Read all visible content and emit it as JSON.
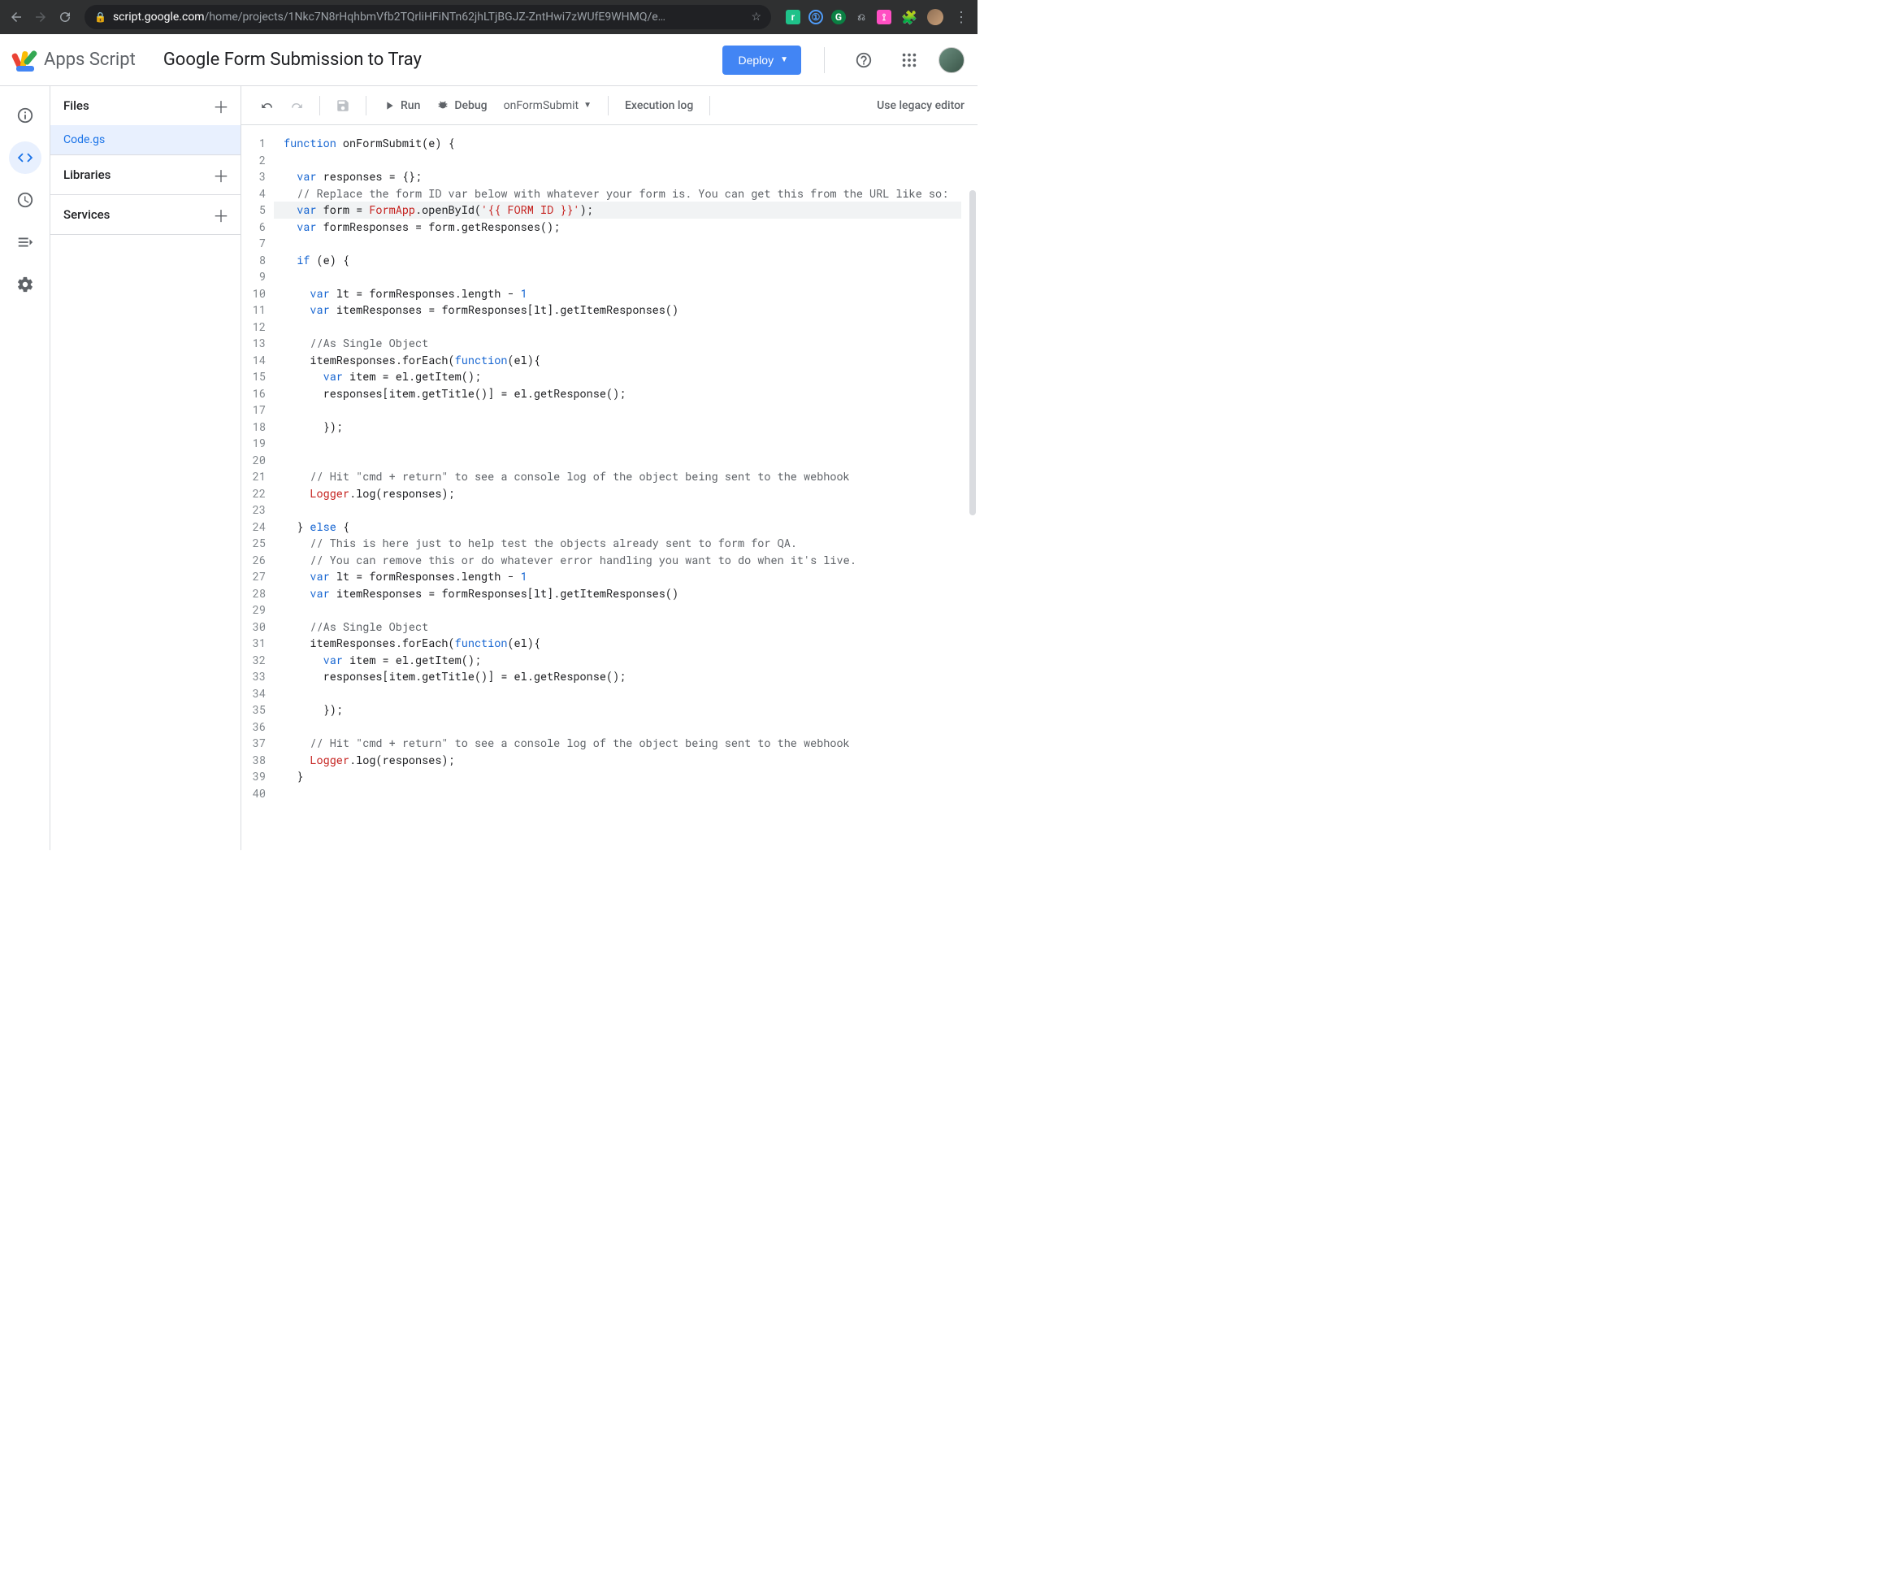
{
  "browser": {
    "url_host": "script.google.com",
    "url_path": "/home/projects/1Nkc7N8rHqhbmVfb2TQrliHFiNTn62jhLTjBGJZ-ZntHwi7zWUfE9WHMQ/e…"
  },
  "header": {
    "product_name": "Apps Script",
    "project_title": "Google Form Submission to Tray",
    "deploy_label": "Deploy"
  },
  "sidebar": {
    "files_label": "Files",
    "file_name": "Code.gs",
    "libraries_label": "Libraries",
    "services_label": "Services"
  },
  "toolbar": {
    "run_label": "Run",
    "debug_label": "Debug",
    "function_selected": "onFormSubmit",
    "execution_log": "Execution log",
    "legacy_link": "Use legacy editor"
  },
  "code": {
    "lines": [
      {
        "n": 1,
        "t": "plain",
        "tokens": [
          [
            "kw",
            "function"
          ],
          [
            "",
            " onFormSubmit(e) {"
          ]
        ]
      },
      {
        "n": 2,
        "t": "plain",
        "tokens": [
          [
            "",
            ""
          ]
        ]
      },
      {
        "n": 3,
        "t": "plain",
        "tokens": [
          [
            "",
            "  "
          ],
          [
            "kw",
            "var"
          ],
          [
            "",
            " responses = {};"
          ]
        ]
      },
      {
        "n": 4,
        "t": "plain",
        "tokens": [
          [
            "",
            "  "
          ],
          [
            "com",
            "// Replace the form ID var below with whatever your form is. You can get this from the URL like so:"
          ]
        ]
      },
      {
        "n": 5,
        "t": "highlight",
        "tokens": [
          [
            "",
            "  "
          ],
          [
            "kw",
            "var"
          ],
          [
            "",
            " form = "
          ],
          [
            "cls",
            "FormApp"
          ],
          [
            "",
            ".openById("
          ],
          [
            "str",
            "'{{ FORM ID }}'"
          ],
          [
            "",
            ");"
          ]
        ]
      },
      {
        "n": 6,
        "t": "plain",
        "tokens": [
          [
            "",
            "  "
          ],
          [
            "kw",
            "var"
          ],
          [
            "",
            " formResponses = form.getResponses();"
          ]
        ]
      },
      {
        "n": 7,
        "t": "plain",
        "tokens": [
          [
            "",
            ""
          ]
        ]
      },
      {
        "n": 8,
        "t": "plain",
        "tokens": [
          [
            "",
            "  "
          ],
          [
            "kw",
            "if"
          ],
          [
            "",
            " (e) {"
          ]
        ]
      },
      {
        "n": 9,
        "t": "plain",
        "tokens": [
          [
            "",
            ""
          ]
        ]
      },
      {
        "n": 10,
        "t": "plain",
        "tokens": [
          [
            "",
            "    "
          ],
          [
            "kw",
            "var"
          ],
          [
            "",
            " lt = formResponses.length - "
          ],
          [
            "num",
            "1"
          ]
        ]
      },
      {
        "n": 11,
        "t": "plain",
        "tokens": [
          [
            "",
            "    "
          ],
          [
            "kw",
            "var"
          ],
          [
            "",
            " itemResponses = formResponses[lt].getItemResponses()"
          ]
        ]
      },
      {
        "n": 12,
        "t": "plain",
        "tokens": [
          [
            "",
            ""
          ]
        ]
      },
      {
        "n": 13,
        "t": "plain",
        "tokens": [
          [
            "",
            "    "
          ],
          [
            "com",
            "//As Single Object"
          ]
        ]
      },
      {
        "n": 14,
        "t": "plain",
        "tokens": [
          [
            "",
            "    itemResponses.forEach("
          ],
          [
            "kw",
            "function"
          ],
          [
            "",
            "(el){"
          ]
        ]
      },
      {
        "n": 15,
        "t": "plain",
        "tokens": [
          [
            "",
            "      "
          ],
          [
            "kw",
            "var"
          ],
          [
            "",
            " item = el.getItem();"
          ]
        ]
      },
      {
        "n": 16,
        "t": "plain",
        "tokens": [
          [
            "",
            "      responses[item.getTitle()] = el.getResponse();"
          ]
        ]
      },
      {
        "n": 17,
        "t": "plain",
        "tokens": [
          [
            "",
            ""
          ]
        ]
      },
      {
        "n": 18,
        "t": "plain",
        "tokens": [
          [
            "",
            "      });"
          ]
        ]
      },
      {
        "n": 19,
        "t": "plain",
        "tokens": [
          [
            "",
            ""
          ]
        ]
      },
      {
        "n": 20,
        "t": "plain",
        "tokens": [
          [
            "",
            ""
          ]
        ]
      },
      {
        "n": 21,
        "t": "plain",
        "tokens": [
          [
            "",
            "    "
          ],
          [
            "com",
            "// Hit \"cmd + return\" to see a console log of the object being sent to the webhook"
          ]
        ]
      },
      {
        "n": 22,
        "t": "plain",
        "tokens": [
          [
            "",
            "    "
          ],
          [
            "cls",
            "Logger"
          ],
          [
            "",
            ".log(responses);"
          ]
        ]
      },
      {
        "n": 23,
        "t": "plain",
        "tokens": [
          [
            "",
            ""
          ]
        ]
      },
      {
        "n": 24,
        "t": "plain",
        "tokens": [
          [
            "",
            "  } "
          ],
          [
            "kw",
            "else"
          ],
          [
            "",
            " {"
          ]
        ]
      },
      {
        "n": 25,
        "t": "plain",
        "tokens": [
          [
            "",
            "    "
          ],
          [
            "com",
            "// This is here just to help test the objects already sent to form for QA."
          ]
        ]
      },
      {
        "n": 26,
        "t": "plain",
        "tokens": [
          [
            "",
            "    "
          ],
          [
            "com",
            "// You can remove this or do whatever error handling you want to do when it's live."
          ]
        ]
      },
      {
        "n": 27,
        "t": "plain",
        "tokens": [
          [
            "",
            "    "
          ],
          [
            "kw",
            "var"
          ],
          [
            "",
            " lt = formResponses.length - "
          ],
          [
            "num",
            "1"
          ]
        ]
      },
      {
        "n": 28,
        "t": "plain",
        "tokens": [
          [
            "",
            "    "
          ],
          [
            "kw",
            "var"
          ],
          [
            "",
            " itemResponses = formResponses[lt].getItemResponses()"
          ]
        ]
      },
      {
        "n": 29,
        "t": "plain",
        "tokens": [
          [
            "",
            ""
          ]
        ]
      },
      {
        "n": 30,
        "t": "plain",
        "tokens": [
          [
            "",
            "    "
          ],
          [
            "com",
            "//As Single Object"
          ]
        ]
      },
      {
        "n": 31,
        "t": "plain",
        "tokens": [
          [
            "",
            "    itemResponses.forEach("
          ],
          [
            "kw",
            "function"
          ],
          [
            "",
            "(el){"
          ]
        ]
      },
      {
        "n": 32,
        "t": "plain",
        "tokens": [
          [
            "",
            "      "
          ],
          [
            "kw",
            "var"
          ],
          [
            "",
            " item = el.getItem();"
          ]
        ]
      },
      {
        "n": 33,
        "t": "plain",
        "tokens": [
          [
            "",
            "      responses[item.getTitle()] = el.getResponse();"
          ]
        ]
      },
      {
        "n": 34,
        "t": "plain",
        "tokens": [
          [
            "",
            ""
          ]
        ]
      },
      {
        "n": 35,
        "t": "plain",
        "tokens": [
          [
            "",
            "      });"
          ]
        ]
      },
      {
        "n": 36,
        "t": "plain",
        "tokens": [
          [
            "",
            ""
          ]
        ]
      },
      {
        "n": 37,
        "t": "plain",
        "tokens": [
          [
            "",
            "    "
          ],
          [
            "com",
            "// Hit \"cmd + return\" to see a console log of the object being sent to the webhook"
          ]
        ]
      },
      {
        "n": 38,
        "t": "plain",
        "tokens": [
          [
            "",
            "    "
          ],
          [
            "cls",
            "Logger"
          ],
          [
            "",
            ".log(responses);"
          ]
        ]
      },
      {
        "n": 39,
        "t": "plain",
        "tokens": [
          [
            "",
            "  }"
          ]
        ]
      },
      {
        "n": 40,
        "t": "plain",
        "tokens": [
          [
            "",
            ""
          ]
        ]
      }
    ]
  }
}
